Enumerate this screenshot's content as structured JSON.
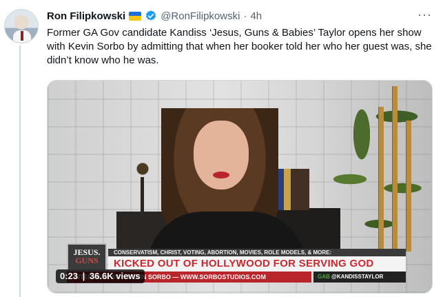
{
  "tweet": {
    "author_name": "Ron Filipkowski",
    "handle": "@RonFilipkowski",
    "separator": "·",
    "time": "4h",
    "more_label": "···",
    "text": "Former GA Gov candidate Kandiss ‘Jesus, Guns & Babies’ Taylor opens her show with Kevin Sorbo by admitting that when her booker told her who her guest was, she didn’t know who he was."
  },
  "video": {
    "logo_line1": "JESUS.",
    "logo_line2": "GUNS",
    "banner_top": "CONSERVATISM, CHRIST, VOTING, ABORTION, MOVIES, ROLE MODELS, & MORE:",
    "banner_main": "KICKED OUT OF HOLLYWOOD FOR SERVING GOD",
    "banner_bottom": "INTERVIEW WITH KEVIN SORBO — WWW.SORBOSTUDIOS.COM",
    "gab_label": "GAB",
    "gab_handle": "@KANDISSTAYLOR",
    "duration": "0:23",
    "views": "36.6K views"
  },
  "colors": {
    "accent_verified": "#1d9bf0",
    "text_primary": "#0f1419",
    "text_secondary": "#536471",
    "banner_red": "#c8282e"
  },
  "icons": [
    "avatar",
    "ukraine-flag-icon",
    "verified-badge-icon",
    "more-options-icon"
  ]
}
